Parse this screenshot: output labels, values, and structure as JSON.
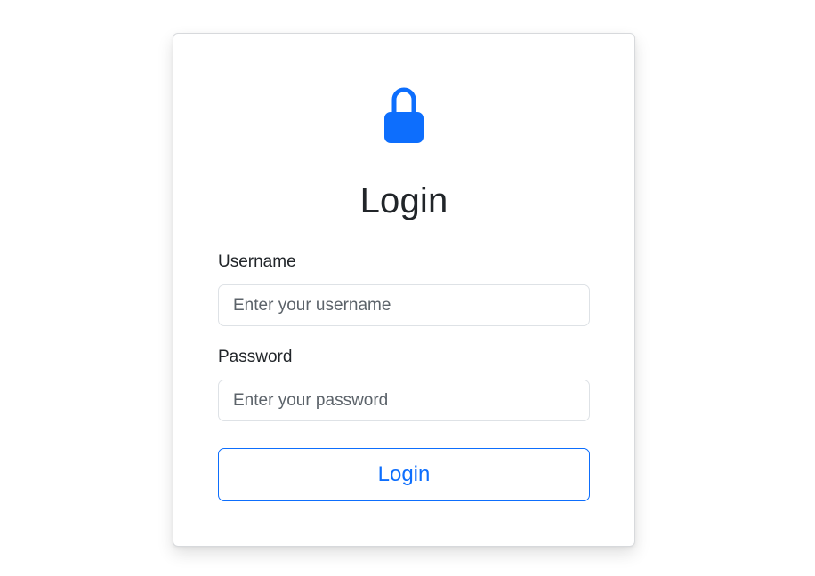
{
  "brand": {
    "accent_color": "#0d6efd"
  },
  "header": {
    "icon": "lock-icon",
    "title": "Login"
  },
  "form": {
    "username": {
      "label": "Username",
      "value": "",
      "placeholder": "Enter your username"
    },
    "password": {
      "label": "Password",
      "value": "",
      "placeholder": "Enter your password"
    },
    "submit_label": "Login"
  }
}
